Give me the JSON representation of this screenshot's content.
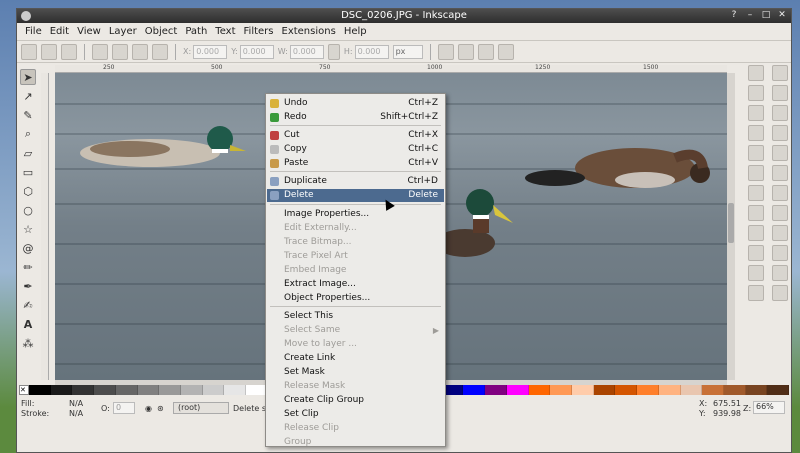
{
  "window": {
    "title": "DSC_0206.JPG - Inkscape"
  },
  "menubar": [
    "File",
    "Edit",
    "View",
    "Layer",
    "Object",
    "Path",
    "Text",
    "Filters",
    "Extensions",
    "Help"
  ],
  "ctrlbar": {
    "x_label": "X:",
    "x_val": "0.000",
    "y_label": "Y:",
    "y_val": "0.000",
    "w_label": "W:",
    "w_val": "0.000",
    "h_label": "H:",
    "h_val": "0.000",
    "unit": "px"
  },
  "ruler": [
    "250",
    "500",
    "750",
    "1000",
    "1250",
    "1500"
  ],
  "context_menu": {
    "items": [
      {
        "label": "Undo",
        "shortcut": "Ctrl+Z",
        "disabled": false
      },
      {
        "label": "Redo",
        "shortcut": "Shift+Ctrl+Z",
        "disabled": false
      },
      {
        "label": "Cut",
        "shortcut": "Ctrl+X",
        "disabled": false
      },
      {
        "label": "Copy",
        "shortcut": "Ctrl+C",
        "disabled": false
      },
      {
        "label": "Paste",
        "shortcut": "Ctrl+V",
        "disabled": false
      },
      {
        "label": "Duplicate",
        "shortcut": "Ctrl+D",
        "disabled": false
      },
      {
        "label": "Delete",
        "shortcut": "Delete",
        "disabled": false
      },
      {
        "label": "Image Properties...",
        "shortcut": "",
        "disabled": false
      },
      {
        "label": "Edit Externally...",
        "shortcut": "",
        "disabled": true
      },
      {
        "label": "Trace Bitmap...",
        "shortcut": "",
        "disabled": true
      },
      {
        "label": "Trace Pixel Art",
        "shortcut": "",
        "disabled": true
      },
      {
        "label": "Embed Image",
        "shortcut": "",
        "disabled": true
      },
      {
        "label": "Extract Image...",
        "shortcut": "",
        "disabled": false
      },
      {
        "label": "Object Properties...",
        "shortcut": "",
        "disabled": false
      },
      {
        "label": "Select This",
        "shortcut": "",
        "disabled": false
      },
      {
        "label": "Select Same",
        "shortcut": "",
        "disabled": true
      },
      {
        "label": "Move to layer ...",
        "shortcut": "",
        "disabled": true
      },
      {
        "label": "Create Link",
        "shortcut": "",
        "disabled": false
      },
      {
        "label": "Set Mask",
        "shortcut": "",
        "disabled": false
      },
      {
        "label": "Release Mask",
        "shortcut": "",
        "disabled": true
      },
      {
        "label": "Create Clip Group",
        "shortcut": "",
        "disabled": false
      },
      {
        "label": "Set Clip",
        "shortcut": "",
        "disabled": false
      },
      {
        "label": "Release Clip",
        "shortcut": "",
        "disabled": true
      },
      {
        "label": "Group",
        "shortcut": "",
        "disabled": true
      }
    ]
  },
  "status": {
    "fill_label": "Fill:",
    "fill_val": "N/A",
    "stroke_label": "Stroke:",
    "stroke_val": "N/A",
    "opacity_label": "O:",
    "opacity_val": "0",
    "layer": "(root)",
    "message": "Delete s",
    "x_label": "X:",
    "x_val": "675.51",
    "y_label": "Y:",
    "y_val": "939.98",
    "zoom_label": "Z:",
    "zoom_val": "66%"
  },
  "colors": {
    "menu_highlight": "#4c6a8f",
    "palette": [
      "#000000",
      "#1a1a1a",
      "#333333",
      "#4d4d4d",
      "#666666",
      "#808080",
      "#999999",
      "#b3b3b3",
      "#cccccc",
      "#e6e6e6",
      "#ffffff",
      "#800000",
      "#ff0000",
      "#808000",
      "#ffff00",
      "#008000",
      "#00ff00",
      "#008080",
      "#00ffff",
      "#000080",
      "#0000ff",
      "#800080",
      "#ff00ff",
      "#ff6600",
      "#ff9955",
      "#ffccaa",
      "#aa4400",
      "#d45500",
      "#ff7f2a",
      "#ffb380",
      "#e9c6af",
      "#c87137",
      "#a05a2c",
      "#784421",
      "#502d16"
    ]
  }
}
